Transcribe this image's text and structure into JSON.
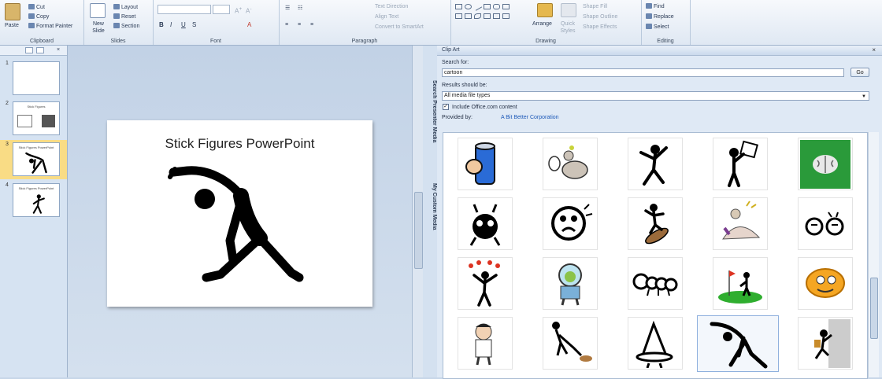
{
  "ribbon": {
    "clipboard": {
      "paste": "Paste",
      "cut": "Cut",
      "copy": "Copy",
      "format_painter": "Format Painter",
      "group_label": "Clipboard"
    },
    "slides": {
      "new_slide": "New Slide",
      "layout": "Layout",
      "reset": "Reset",
      "section": "Section",
      "group_label": "Slides"
    },
    "font": {
      "group_label": "Font"
    },
    "paragraph": {
      "text_direction": "Text Direction",
      "align_text": "Align Text",
      "convert_smartart": "Convert to SmartArt",
      "group_label": "Paragraph"
    },
    "drawing": {
      "arrange": "Arrange",
      "quick_styles": "Quick Styles",
      "shape_fill": "Shape Fill",
      "shape_outline": "Shape Outline",
      "shape_effects": "Shape Effects",
      "group_label": "Drawing"
    },
    "editing": {
      "find": "Find",
      "replace": "Replace",
      "select": "Select",
      "group_label": "Editing"
    }
  },
  "slides_panel": {
    "slides": [
      {
        "num": "1",
        "title": ""
      },
      {
        "num": "2",
        "title": "Stick Figures"
      },
      {
        "num": "3",
        "title": "Stick Figures PowerPoint"
      },
      {
        "num": "4",
        "title": "Stick Figures PowerPoint"
      }
    ]
  },
  "slide": {
    "title": "Stick Figures PowerPoint"
  },
  "side_tabs": {
    "search": "Search Presenter Media",
    "custom": "My Custom Media"
  },
  "clip_art": {
    "title": "Clip Art",
    "search_label": "Search for:",
    "search_value": "cartoon",
    "go_label": "Go",
    "results_label": "Results should be:",
    "results_value": "All media file types",
    "include_office": "Include Office.com content",
    "provided_label": "Provided by:",
    "provider": "A Bit Better Corporation",
    "close_icon": "×"
  }
}
